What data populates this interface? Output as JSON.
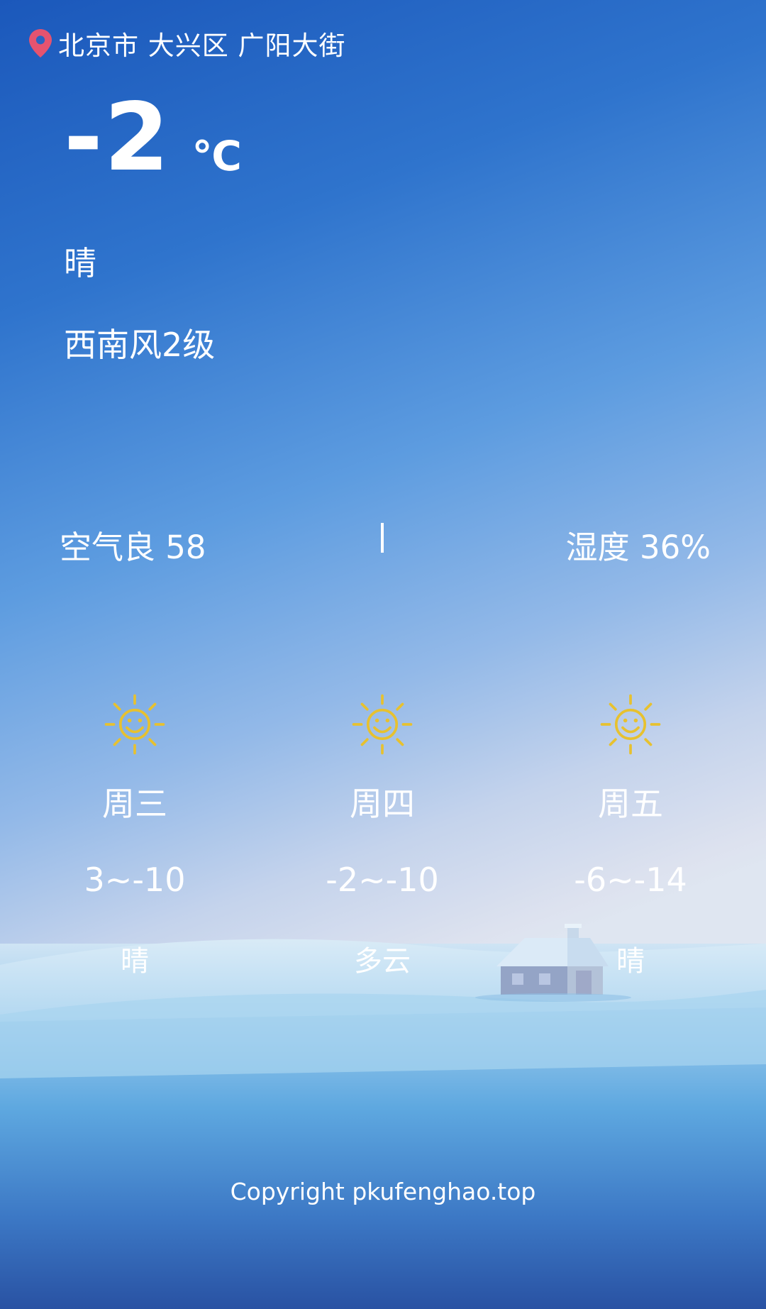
{
  "header": {
    "location": "北京市 大兴区 广阳大街",
    "location_icon": "map-pin-icon"
  },
  "current": {
    "temperature": "-2",
    "unit": "℃",
    "condition": "晴",
    "wind": "西南风2级"
  },
  "stats": {
    "air": "空气良 58",
    "humidity": "湿度 36%"
  },
  "forecast": [
    {
      "day": "周三",
      "range": "3~-10",
      "condition": "晴",
      "icon": "sun-icon"
    },
    {
      "day": "周四",
      "range": "-2~-10",
      "condition": "多云",
      "icon": "sun-icon"
    },
    {
      "day": "周五",
      "range": "-6~-14",
      "condition": "晴",
      "icon": "sun-icon"
    }
  ],
  "footer": {
    "copyright": "Copyright pkufenghao.top"
  },
  "colors": {
    "pin": "#e5536f",
    "sun": "#e7c12f",
    "text": "#ffffff"
  }
}
